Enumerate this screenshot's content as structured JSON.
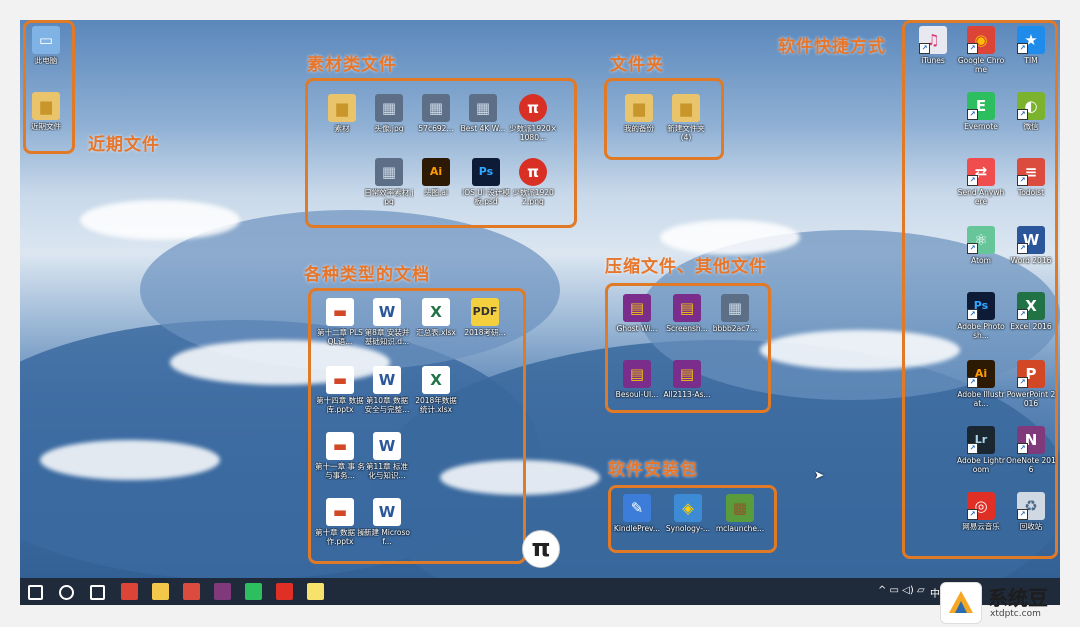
{
  "groups": {
    "recent": "近期文件",
    "materials": "素材类文件",
    "folders": "文件夹",
    "shortcuts": "软件快捷方式",
    "documents": "各种类型的文档",
    "archives": "压缩文件、其他文件",
    "installers": "软件安装包"
  },
  "desktop_left": [
    {
      "label": "此电脑",
      "icon": "computer-icon"
    },
    {
      "label": "近期文件",
      "icon": "folder-icon"
    }
  ],
  "materials": [
    {
      "label": "素材",
      "icon": "folder-icon"
    },
    {
      "label": "头像.jpg",
      "icon": "image-icon"
    },
    {
      "label": "57c692...",
      "icon": "image-icon"
    },
    {
      "label": "Best 4K W...",
      "icon": "image-icon"
    },
    {
      "label": "少数派1920×1080...",
      "icon": "pi-icon"
    },
    {
      "label": "日常效率素材.jpg",
      "icon": "image-icon"
    },
    {
      "label": "头图.ai",
      "icon": "illustrator-icon"
    },
    {
      "label": "iOS UI 设计模板.psd",
      "icon": "photoshop-icon"
    },
    {
      "label": "少数派1920 2.png",
      "icon": "pi-icon"
    }
  ],
  "folders": [
    {
      "label": "我的备份",
      "icon": "folder-icon"
    },
    {
      "label": "新建文件夹 (4)",
      "icon": "folder-icon"
    }
  ],
  "documents": [
    {
      "label": "第十二章 PLSQL语...",
      "icon": "powerpoint-icon"
    },
    {
      "label": "第8章 安装并 基础知识.d...",
      "icon": "word-icon"
    },
    {
      "label": "汇总表.xlsx",
      "icon": "excel-icon"
    },
    {
      "label": "2018考研...",
      "icon": "pdf-icon"
    },
    {
      "label": "第十四章 数据库.pptx",
      "icon": "powerpoint-icon"
    },
    {
      "label": "第10章 数据 安全与完整...",
      "icon": "word-icon"
    },
    {
      "label": "2018年数据 统计.xlsx",
      "icon": "excel-icon"
    },
    {
      "label": "第十一章 事 务与事务...",
      "icon": "powerpoint-icon"
    },
    {
      "label": "第11章 标准 化与知识...",
      "icon": "word-icon"
    },
    {
      "label": "第十章 数据 操作.pptx",
      "icon": "powerpoint-icon"
    },
    {
      "label": "新建 Microsof...",
      "icon": "word-icon"
    }
  ],
  "archives": [
    {
      "label": "Ghost Wi...",
      "icon": "winrar-icon"
    },
    {
      "label": "Screensh...",
      "icon": "winrar-icon"
    },
    {
      "label": "bbbb2ac7...",
      "icon": "image-icon"
    },
    {
      "label": "Besoul-UI...",
      "icon": "winrar-icon"
    },
    {
      "label": "All2113-As...",
      "icon": "winrar-icon"
    }
  ],
  "installers": [
    {
      "label": "KindlePrev...",
      "icon": "kindle-icon"
    },
    {
      "label": "Synology-...",
      "icon": "synology-icon"
    },
    {
      "label": "mclaunche...",
      "icon": "minecraft-icon"
    }
  ],
  "shortcuts": [
    {
      "label": "iTunes",
      "icon": "itunes-icon",
      "color": "#e8e8f0",
      "glyph": "♫",
      "fg": "#d6336c"
    },
    {
      "label": "Google Chrome",
      "icon": "chrome-icon",
      "color": "#db4437",
      "glyph": "◉",
      "fg": "#fbbc05"
    },
    {
      "label": "TIM",
      "icon": "tim-icon",
      "color": "#1f8ceb",
      "glyph": "★",
      "fg": "#ffffff"
    },
    {
      "label": "Evernote",
      "icon": "evernote-icon",
      "color": "#2dbe60",
      "glyph": "E",
      "fg": "#ffffff"
    },
    {
      "label": "微信",
      "icon": "wechat-icon",
      "color": "#7bb32e",
      "glyph": "◐",
      "fg": "#ffffff"
    },
    {
      "label": "Send Anywhere",
      "icon": "send-anywhere-icon",
      "color": "#f04e4e",
      "glyph": "⇄",
      "fg": "#ffffff"
    },
    {
      "label": "Todoist",
      "icon": "todoist-icon",
      "color": "#db4c3f",
      "glyph": "≡",
      "fg": "#ffffff"
    },
    {
      "label": "Atom",
      "icon": "atom-icon",
      "color": "#66c69a",
      "glyph": "⚛",
      "fg": "#ffffff"
    },
    {
      "label": "Word 2016",
      "icon": "word-icon",
      "color": "#2b579a",
      "glyph": "W",
      "fg": "#ffffff"
    },
    {
      "label": "Adobe Photosh...",
      "icon": "photoshop-icon",
      "color": "#0d1b36",
      "glyph": "Ps",
      "fg": "#31a8ff"
    },
    {
      "label": "Excel 2016",
      "icon": "excel-icon",
      "color": "#217346",
      "glyph": "X",
      "fg": "#ffffff"
    },
    {
      "label": "Adobe Illustrat...",
      "icon": "illustrator-icon",
      "color": "#2d1a05",
      "glyph": "Ai",
      "fg": "#ff9a00"
    },
    {
      "label": "PowerPoint 2016",
      "icon": "powerpoint-icon",
      "color": "#d24726",
      "glyph": "P",
      "fg": "#ffffff"
    },
    {
      "label": "Adobe Lightroom",
      "icon": "lightroom-icon",
      "color": "#1a2630",
      "glyph": "Lr",
      "fg": "#add5ec"
    },
    {
      "label": "OneNote 2016",
      "icon": "onenote-icon",
      "color": "#80397b",
      "glyph": "N",
      "fg": "#ffffff"
    },
    {
      "label": "网易云音乐",
      "icon": "netease-music-icon",
      "color": "#e03026",
      "glyph": "◎",
      "fg": "#ffffff"
    },
    {
      "label": "回收站",
      "icon": "recycle-bin-icon",
      "color": "#cfd8e3",
      "glyph": "♻",
      "fg": "#4d6a8a"
    }
  ],
  "taskbar": {
    "items": [
      "start-icon",
      "cortana-icon",
      "task-view-icon",
      "chrome-icon",
      "file-explorer-icon",
      "todoist-icon",
      "onenote-icon",
      "evernote-icon",
      "netease-music-icon",
      "sticky-notes-icon"
    ],
    "tray_ime": "中",
    "tray_symbols": "^ ▭ ◁) ▱"
  },
  "watermark": {
    "name": "系统豆",
    "url": "xtdptc.com"
  }
}
